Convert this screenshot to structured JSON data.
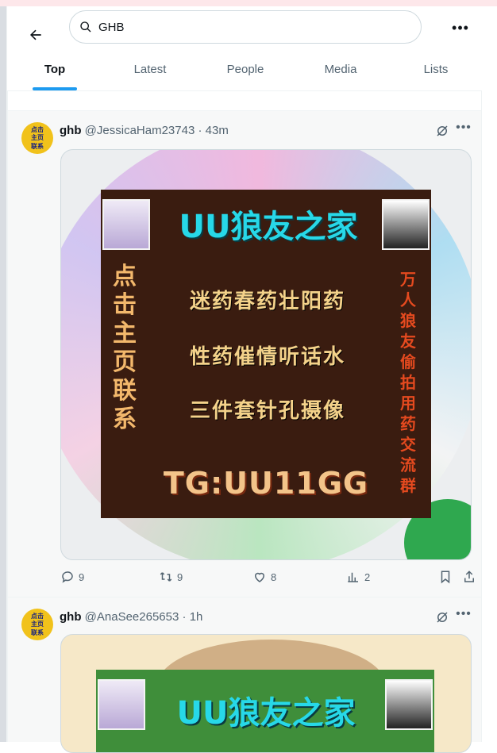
{
  "header": {
    "search_value": "GHB",
    "tabs": [
      {
        "label": "Top",
        "active": true
      },
      {
        "label": "Latest",
        "active": false
      },
      {
        "label": "People",
        "active": false
      },
      {
        "label": "Media",
        "active": false
      },
      {
        "label": "Lists",
        "active": false
      }
    ]
  },
  "posts": [
    {
      "name": "ghb",
      "handle": "@JessicaHam23743",
      "time": "43m",
      "avatar_text": [
        "点击",
        "主页",
        "联系"
      ],
      "image": {
        "title": "UU狼友之家",
        "lines": [
          "迷药春药壮阳药",
          "性药催情听话水",
          "三件套针孔摄像"
        ],
        "left_vertical": "点击主页联系",
        "right_vertical": "万人狼友偷拍用药交流群",
        "tg": "TG:UU11GG"
      },
      "stats": {
        "replies": "9",
        "reposts": "9",
        "likes": "8",
        "views": "2"
      }
    },
    {
      "name": "ghb",
      "handle": "@AnaSee265653",
      "time": "1h",
      "avatar_text": [
        "点击",
        "主页",
        "联系"
      ],
      "image": {
        "title": "UU狼友之家"
      }
    }
  ],
  "colors": {
    "accent": "#1d9bf0",
    "secondary_text": "#536471"
  }
}
